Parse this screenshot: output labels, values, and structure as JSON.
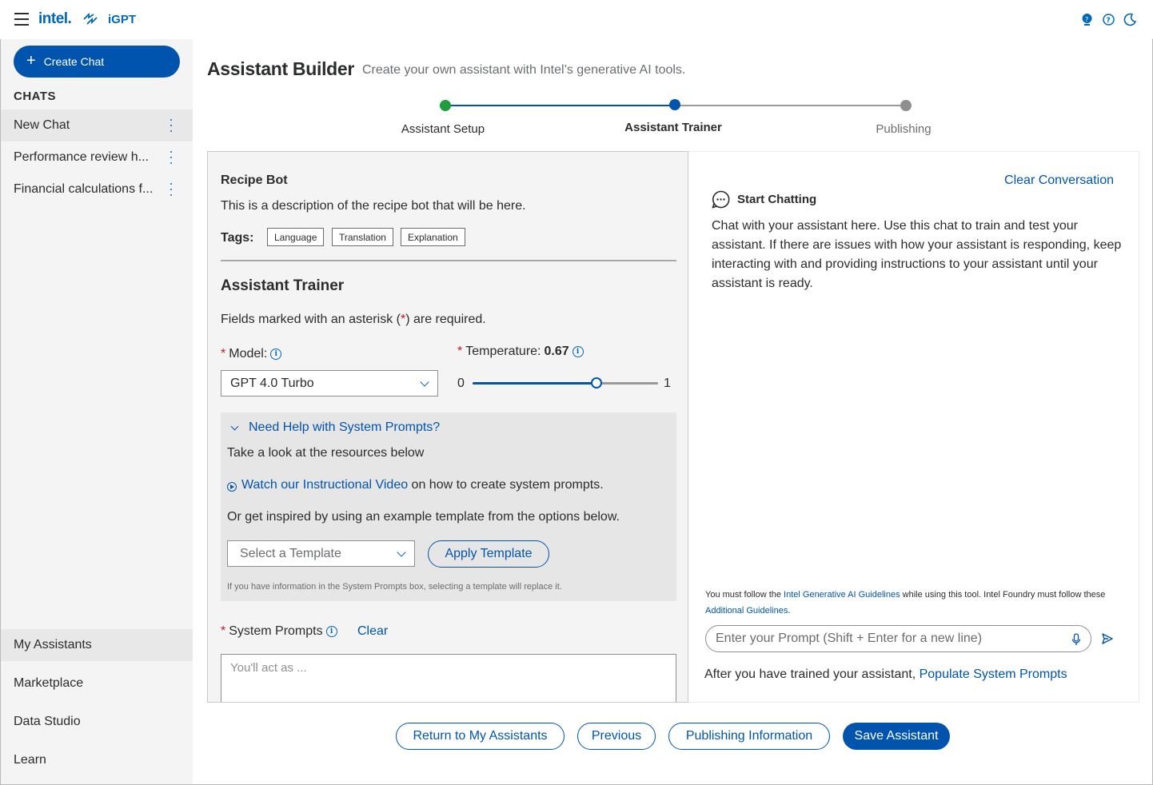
{
  "brand": {
    "intel": "intel.",
    "product": "iGPT"
  },
  "sidebar": {
    "create_chat": "Create Chat",
    "chats_title": "CHATS",
    "chats": [
      {
        "label": "New Chat"
      },
      {
        "label": "Performance review h..."
      },
      {
        "label": "Financial calculations f..."
      }
    ],
    "nav": [
      {
        "label": "My Assistants"
      },
      {
        "label": "Marketplace"
      },
      {
        "label": "Data Studio"
      },
      {
        "label": "Learn"
      }
    ]
  },
  "header": {
    "title": "Assistant Builder",
    "subtitle": "Create your own assistant  with Intel’s generative AI tools."
  },
  "stepper": {
    "steps": [
      {
        "label": "Assistant Setup",
        "status": "complete",
        "color": "#1e9e3a"
      },
      {
        "label": "Assistant Trainer",
        "status": "current",
        "color": "#0054ae"
      },
      {
        "label": "Publishing",
        "status": "upcoming",
        "color": "#8d8f91"
      }
    ]
  },
  "assistant": {
    "name": "Recipe Bot",
    "description": "This is a description of the recipe bot that will be here.",
    "tags_label": "Tags:",
    "tags": [
      "Language",
      "Translation",
      "Explanation"
    ]
  },
  "trainer": {
    "title": "Assistant Trainer",
    "required_note_pre": "Fields marked with an asterisk (",
    "required_star": "*",
    "required_note_post": ") are required.",
    "model_label": "Model:",
    "model_value": "GPT 4.0 Turbo",
    "temperature_label": "Temperature:",
    "temperature_value": "0.67",
    "temperature_fraction": 0.67,
    "temp_min": "0",
    "temp_max": "1"
  },
  "help": {
    "toggle": "Need Help with System Prompts?",
    "line1": "Take a look at the resources below",
    "video_link": "Watch our Instructional Video",
    "video_suffix": " on how to create  system prompts.",
    "line3": "Or get inspired by using an example template from the options below.",
    "template_placeholder": "Select a Template",
    "apply_button": "Apply Template",
    "note": "If you have information in the System Prompts box, selecting a template will replace it."
  },
  "system_prompts": {
    "label": "System Prompts",
    "clear": "Clear",
    "placeholder": "You'll act as ..."
  },
  "chat_panel": {
    "clear_conversation": "Clear Conversation",
    "title": "Start Chatting",
    "description": "Chat with your assistant here. Use this chat to train and test your assistant. If there are issues with how your assistant is responding, keep interacting with and providing instructions to your assistant until your assistant is ready.",
    "guide_pre": "You must follow the ",
    "guide_link1": "Intel Generative AI Guidelines",
    "guide_mid": " while using this tool. Intel Foundry must follow these ",
    "guide_link2": "Additional Guidelines",
    "guide_end": ".",
    "prompt_placeholder": "Enter  your Prompt (Shift + Enter for a new line)",
    "populate_pre": "After you have trained your assistant, ",
    "populate_link": "Populate System Prompts"
  },
  "footer": {
    "return": "Return to My Assistants",
    "previous": "Previous",
    "publishing": "Publishing Information",
    "save": "Save Assistant"
  },
  "colors": {
    "accent": "#0054ae",
    "brand": "#0068b5",
    "required": "#c81326",
    "complete": "#1e9e3a"
  }
}
